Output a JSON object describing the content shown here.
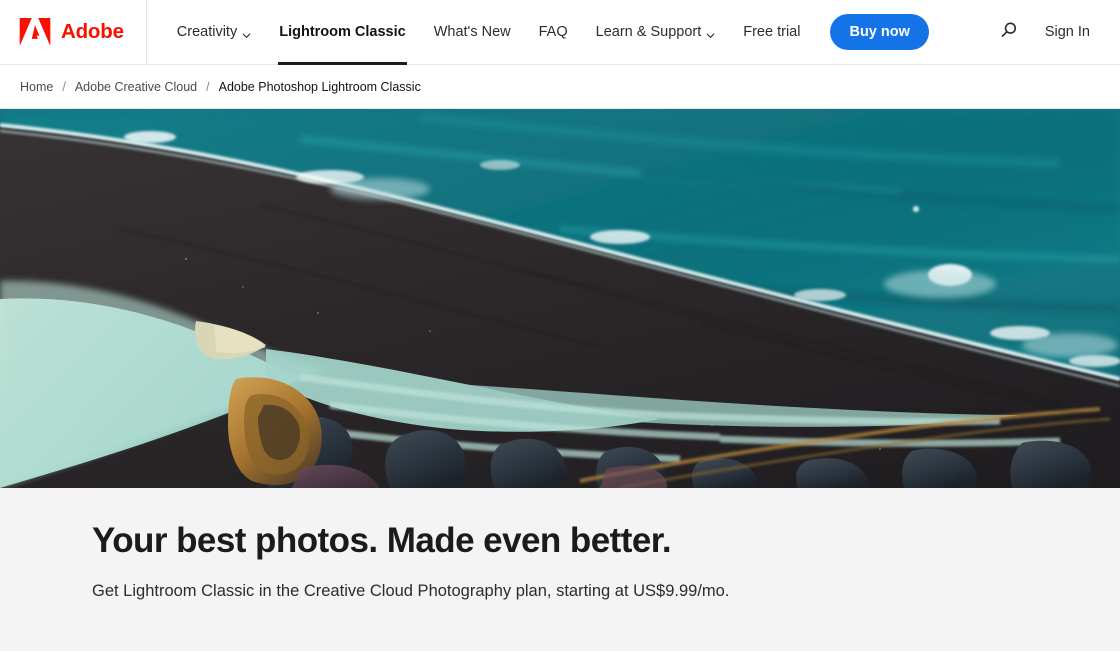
{
  "brand": {
    "name": "Adobe",
    "logo_icon": "adobe-a-logo",
    "logo_color": "#fa0f00"
  },
  "globalnav": {
    "items": [
      {
        "label": "Creativity",
        "has_chevron": true,
        "active": false,
        "icon": "chevron-down-icon"
      },
      {
        "label": "Lightroom Classic",
        "has_chevron": false,
        "active": true,
        "icon": ""
      },
      {
        "label": "What's New",
        "has_chevron": false,
        "active": false,
        "icon": ""
      },
      {
        "label": "FAQ",
        "has_chevron": false,
        "active": false,
        "icon": ""
      },
      {
        "label": "Learn & Support",
        "has_chevron": true,
        "active": false,
        "icon": "chevron-down-icon"
      },
      {
        "label": "Free trial",
        "has_chevron": false,
        "active": false,
        "icon": ""
      }
    ],
    "buy_button": {
      "label": "Buy now",
      "color": "#1473e6",
      "text_color": "#ffffff"
    },
    "search": {
      "icon": "search-icon",
      "label": "Search"
    },
    "sign_in": {
      "label": "Sign In"
    },
    "active_underline_color": "#1d1d1d"
  },
  "breadcrumb": {
    "separator": "/",
    "items": [
      {
        "label": "Home",
        "current": false
      },
      {
        "label": "Adobe Creative Cloud",
        "current": false
      },
      {
        "label": "Adobe Photoshop Lightroom Classic",
        "current": true
      }
    ]
  },
  "hero": {
    "image_alt": "Aerial view of a black sand beach with turquoise ocean waves and glacial river delta",
    "ocean_color": "#12707e",
    "ocean_deep_color": "#0d5d6b",
    "sand_color": "#2e2b2c",
    "river_color": "#a9dcd0",
    "foam_color": "#f2f7f7",
    "ochre_color": "#b98a3f"
  },
  "hero_copy": {
    "background": "#f4f4f4",
    "title": "Your best photos. Made even better.",
    "subtitle": "Get Lightroom Classic in the Creative Cloud Photography plan, starting at US$9.99/mo."
  }
}
